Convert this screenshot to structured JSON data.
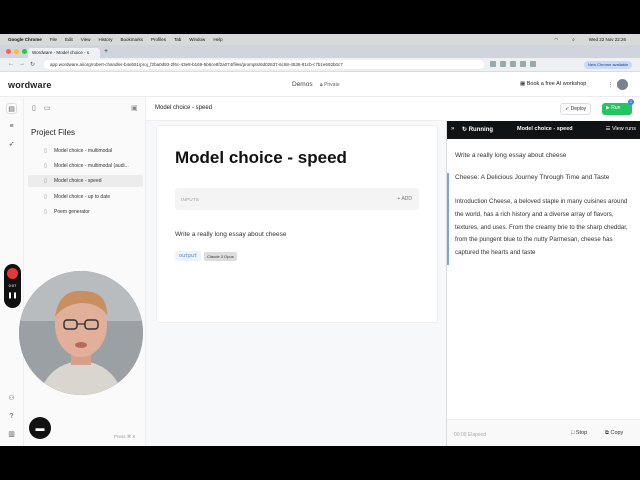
{
  "menubar": {
    "app": "Google Chrome",
    "items": [
      "File",
      "Edit",
      "View",
      "History",
      "Bookmarks",
      "Profiles",
      "Tab",
      "Window",
      "Help"
    ],
    "clock": "Wed 22 Nov 22:26"
  },
  "browser": {
    "tab_title": "Wordware - Model choice - s",
    "url": "app.wordware.ai/org/robert-chandler-b4eb51/proj_f2ba0d93-2f6c-43e8-b169-5b6ce8f2a074/files/prompts/6d02637-6c68-4536-81cb-c7b1e692b0c7",
    "new_chrome": "New Chrome available"
  },
  "header": {
    "logo": "wordware",
    "project": "Demos",
    "visibility": "Private",
    "workshop": "Book a free AI workshop"
  },
  "recorder": {
    "time": "0:07"
  },
  "sidebar": {
    "title": "Project Files",
    "files": [
      {
        "label": "Model choice - multimodal",
        "selected": false
      },
      {
        "label": "Model choice - multimodal (audi...",
        "selected": false
      },
      {
        "label": "Model choice - speed",
        "selected": true
      },
      {
        "label": "Model choice - up to date",
        "selected": false
      },
      {
        "label": "Poem generator",
        "selected": false
      }
    ],
    "hint": "Press ⌘ K"
  },
  "editor": {
    "tab_title": "Model choice - speed",
    "title": "Model choice - speed",
    "inputs_label": "INPUTS",
    "add_label": "+ ADD",
    "prompt": "Write a really long essay about cheese",
    "output_tag": "output",
    "model_tag": "Claude 3 Opus"
  },
  "toolbar": {
    "deploy": "Deploy",
    "run": "Run",
    "run_badge": "1"
  },
  "run_panel": {
    "status": "Running",
    "title": "Model choice - speed",
    "view_runs": "View runs",
    "prompt_echo": "Write a really long essay about cheese",
    "heading": "Cheese: A Delicious Journey Through Time and Taste",
    "body": "Introduction Cheese, a beloved staple in many cuisines around the world, has a rich history and a diverse array of flavors, textures, and uses. From the creamy brie to the sharp cheddar, from the pungent blue to the nutty Parmesan, cheese has captured the hearts and taste",
    "elapsed": "00:09 Elapsed",
    "stop": "Stop",
    "copy": "Copy"
  },
  "colors": {
    "run_green": "#22c55e",
    "record_red": "#e53935",
    "accent_blue": "#3b82f6"
  }
}
